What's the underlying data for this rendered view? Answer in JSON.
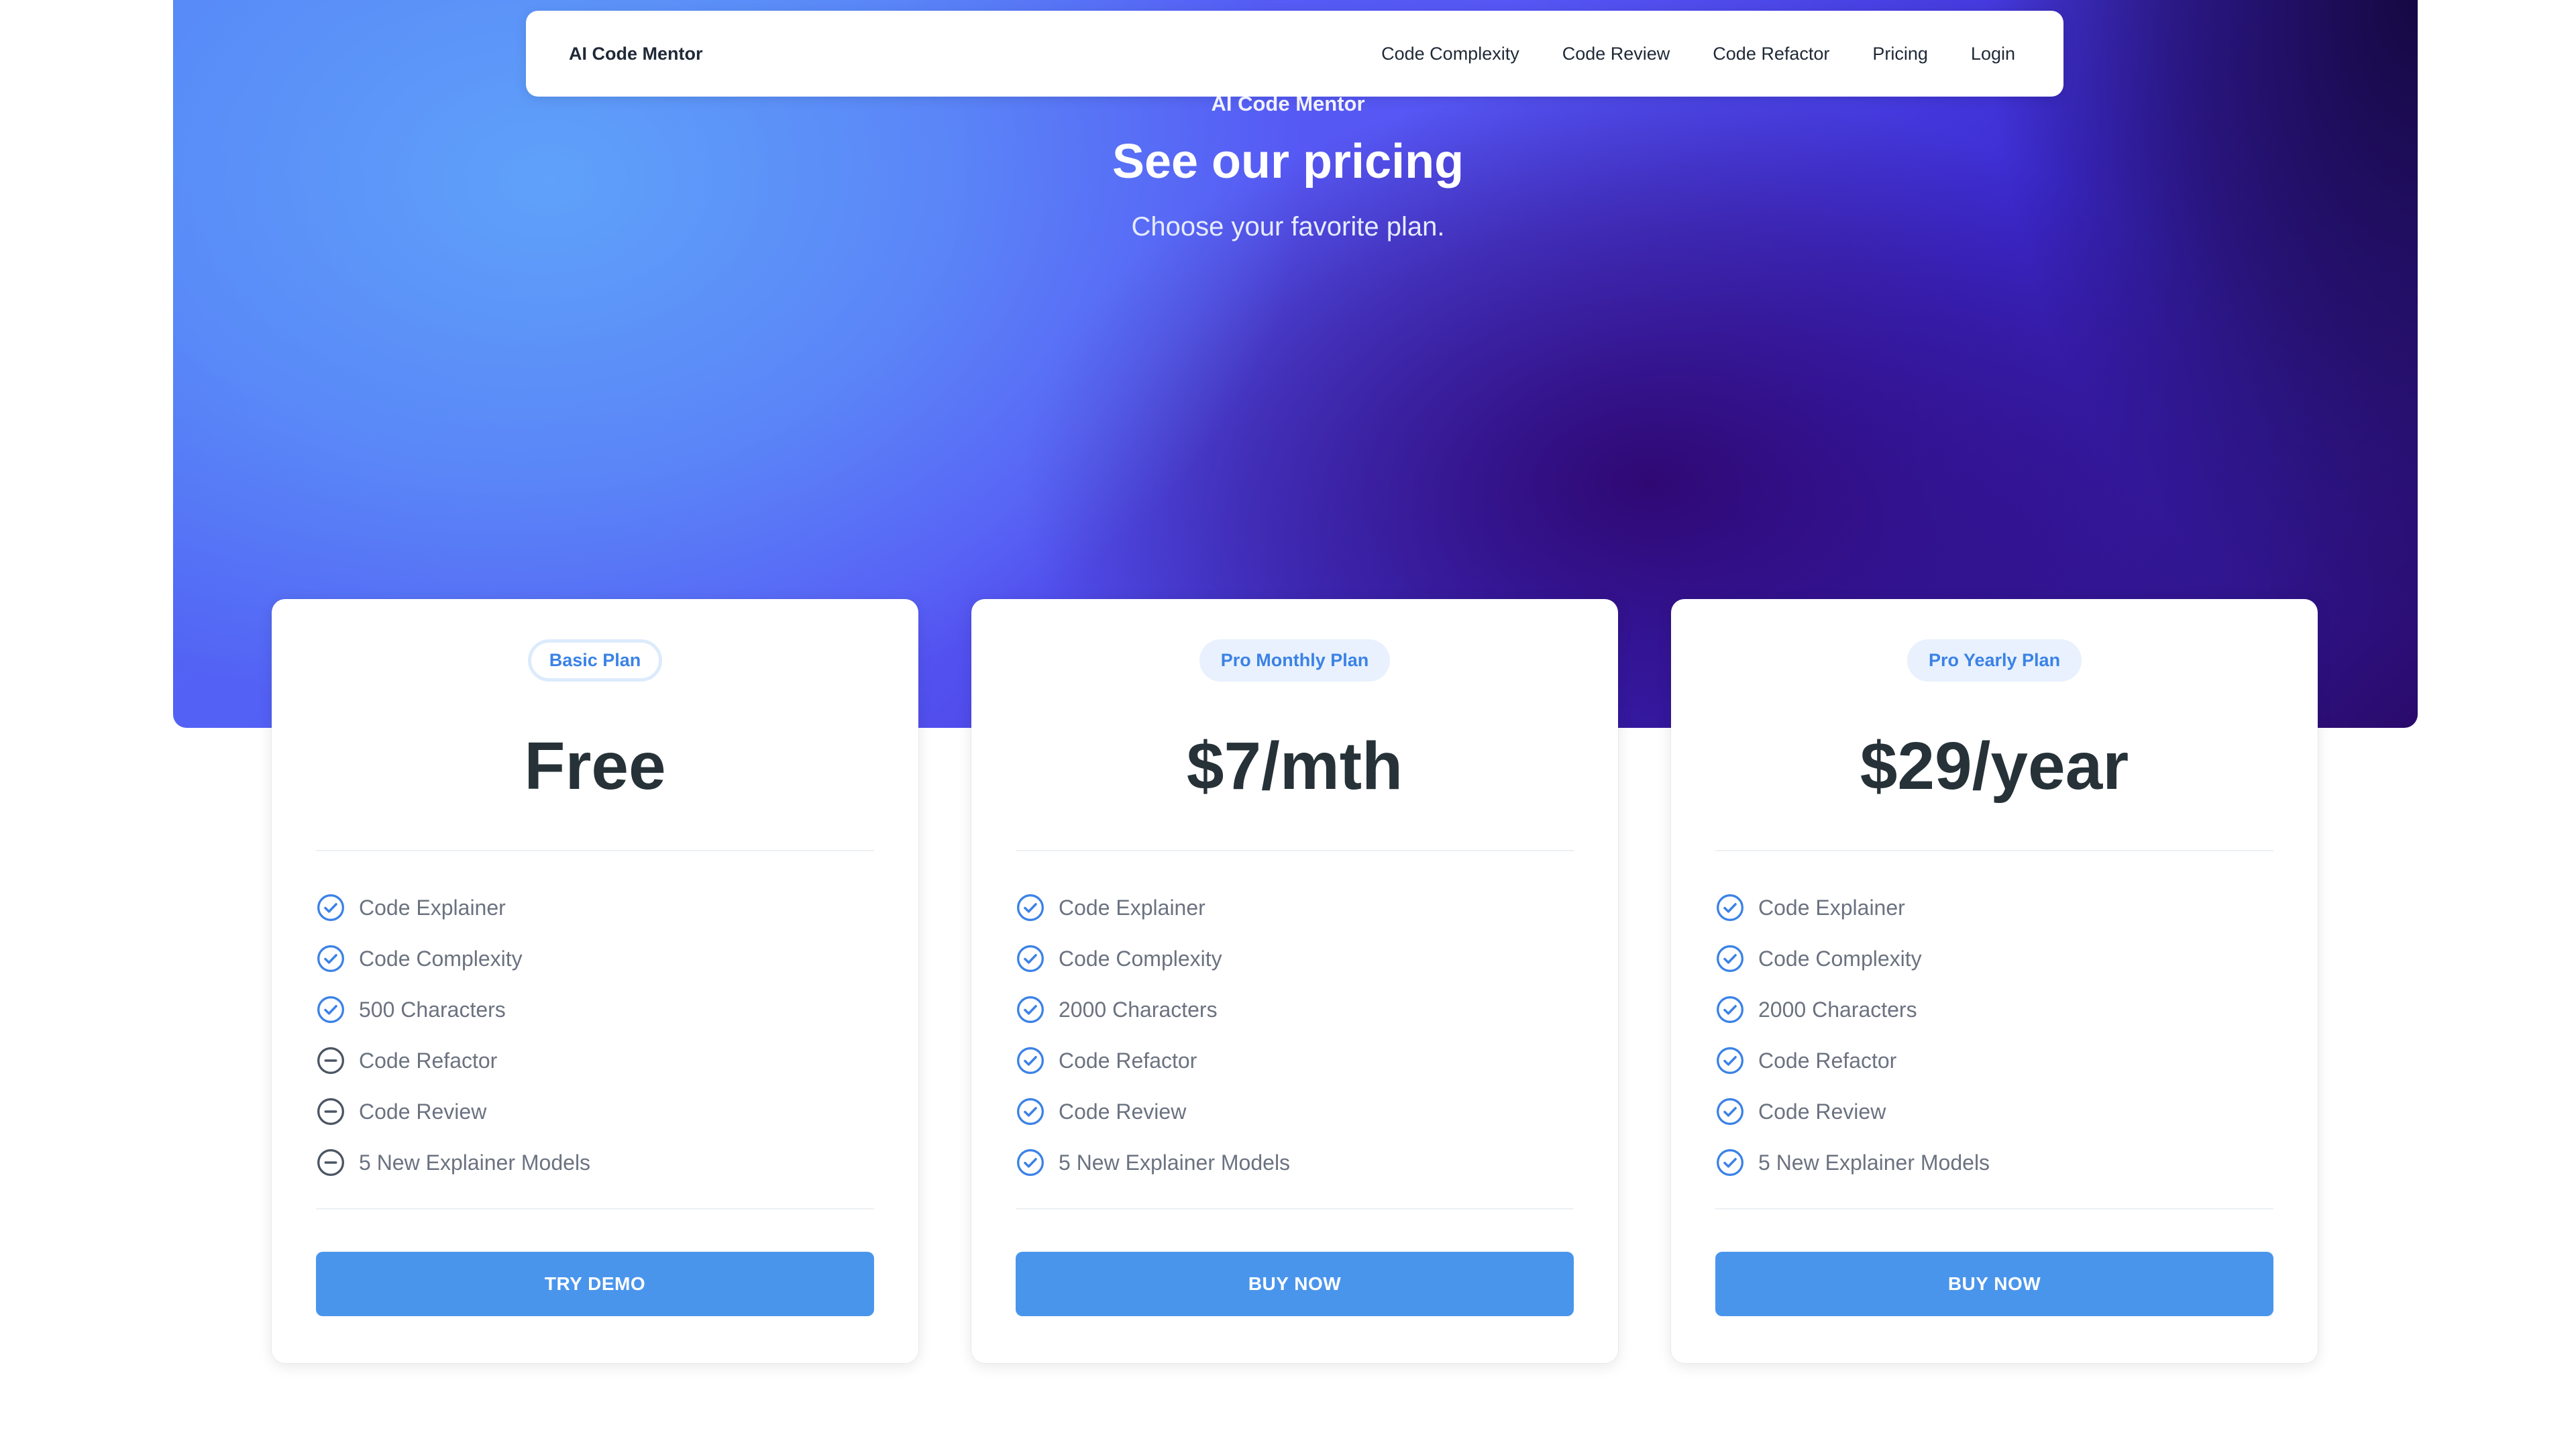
{
  "header": {
    "brand": "AI Code Mentor",
    "nav": [
      {
        "label": "Code Complexity"
      },
      {
        "label": "Code Review"
      },
      {
        "label": "Code Refactor"
      },
      {
        "label": "Pricing"
      },
      {
        "label": "Login"
      }
    ]
  },
  "hero": {
    "eyebrow": "AI Code Mentor",
    "title": "See our pricing",
    "subtitle": "Choose your favorite plan."
  },
  "colors": {
    "accent": "#4a95ec",
    "badge_text": "#3b82e6",
    "check_icon": "#3b82e6",
    "minus_icon": "#4b5563",
    "price_text": "#263238",
    "feature_text": "#6b7280"
  },
  "plans": [
    {
      "badge": "Basic Plan",
      "badge_style": "outlined",
      "price": "Free",
      "features": [
        {
          "label": "Code Explainer",
          "included": true,
          "icon": "check-circle-icon"
        },
        {
          "label": "Code Complexity",
          "included": true,
          "icon": "check-circle-icon"
        },
        {
          "label": "500 Characters",
          "included": true,
          "icon": "check-circle-icon"
        },
        {
          "label": "Code Refactor",
          "included": false,
          "icon": "minus-circle-icon"
        },
        {
          "label": "Code Review",
          "included": false,
          "icon": "minus-circle-icon"
        },
        {
          "label": "5 New Explainer Models",
          "included": false,
          "icon": "minus-circle-icon"
        }
      ],
      "cta": "TRY DEMO"
    },
    {
      "badge": "Pro Monthly Plan",
      "badge_style": "filled",
      "price": "$7/mth",
      "features": [
        {
          "label": "Code Explainer",
          "included": true,
          "icon": "check-circle-icon"
        },
        {
          "label": "Code Complexity",
          "included": true,
          "icon": "check-circle-icon"
        },
        {
          "label": "2000 Characters",
          "included": true,
          "icon": "check-circle-icon"
        },
        {
          "label": "Code Refactor",
          "included": true,
          "icon": "check-circle-icon"
        },
        {
          "label": "Code Review",
          "included": true,
          "icon": "check-circle-icon"
        },
        {
          "label": "5 New Explainer Models",
          "included": true,
          "icon": "check-circle-icon"
        }
      ],
      "cta": "BUY NOW"
    },
    {
      "badge": "Pro Yearly Plan",
      "badge_style": "filled",
      "price": "$29/year",
      "features": [
        {
          "label": "Code Explainer",
          "included": true,
          "icon": "check-circle-icon"
        },
        {
          "label": "Code Complexity",
          "included": true,
          "icon": "check-circle-icon"
        },
        {
          "label": "2000 Characters",
          "included": true,
          "icon": "check-circle-icon"
        },
        {
          "label": "Code Refactor",
          "included": true,
          "icon": "check-circle-icon"
        },
        {
          "label": "Code Review",
          "included": true,
          "icon": "check-circle-icon"
        },
        {
          "label": "5 New Explainer Models",
          "included": true,
          "icon": "check-circle-icon"
        }
      ],
      "cta": "BUY NOW"
    }
  ]
}
